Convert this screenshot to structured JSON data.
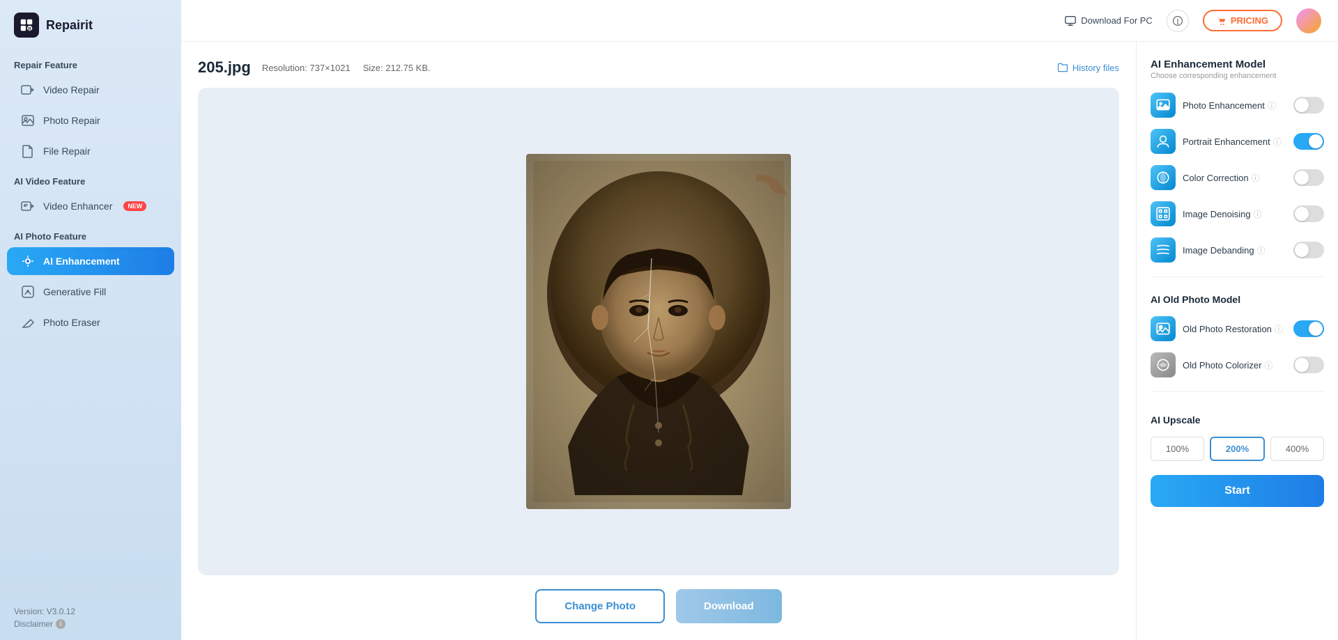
{
  "app": {
    "name": "Repairit",
    "version": "Version: V3.0.12",
    "disclaimer": "Disclaimer"
  },
  "header": {
    "download_for_pc": "Download For PC",
    "pricing": "PRICING",
    "help_icon": "?"
  },
  "sidebar": {
    "repair_feature_label": "Repair Feature",
    "items_repair": [
      {
        "id": "video-repair",
        "label": "Video Repair"
      },
      {
        "id": "photo-repair",
        "label": "Photo Repair"
      },
      {
        "id": "file-repair",
        "label": "File Repair"
      }
    ],
    "ai_video_feature_label": "AI Video Feature",
    "items_ai_video": [
      {
        "id": "video-enhancer",
        "label": "Video Enhancer",
        "badge": "NEW"
      }
    ],
    "ai_photo_feature_label": "AI Photo Feature",
    "items_ai_photo": [
      {
        "id": "ai-enhancement",
        "label": "AI Enhancement",
        "active": true
      },
      {
        "id": "generative-fill",
        "label": "Generative Fill"
      },
      {
        "id": "photo-eraser",
        "label": "Photo Eraser"
      }
    ]
  },
  "file": {
    "name": "205.jpg",
    "resolution_label": "Resolution:",
    "resolution_value": "737×1021",
    "size_label": "Size:",
    "size_value": "212.75 KB."
  },
  "history_files": "History files",
  "right_panel": {
    "ai_enhancement_model_title": "AI Enhancement Model",
    "ai_enhancement_model_sub": "Choose corresponding enhancement",
    "features": [
      {
        "id": "photo-enhancement",
        "label": "Photo Enhancement",
        "on": false
      },
      {
        "id": "portrait-enhancement",
        "label": "Portrait Enhancement",
        "on": true
      },
      {
        "id": "color-correction",
        "label": "Color Correction",
        "on": false
      },
      {
        "id": "image-denoising",
        "label": "Image Denoising",
        "on": false
      },
      {
        "id": "image-debanding",
        "label": "Image Debanding",
        "on": false
      }
    ],
    "ai_old_photo_model_title": "AI Old Photo Model",
    "old_photo_features": [
      {
        "id": "old-photo-restoration",
        "label": "Old Photo Restoration",
        "on": true
      },
      {
        "id": "old-photo-colorizer",
        "label": "Old Photo Colorizer",
        "on": false
      }
    ],
    "ai_upscale_title": "AI Upscale",
    "upscale_options": [
      {
        "value": "100%",
        "active": false
      },
      {
        "value": "200%",
        "active": true
      },
      {
        "value": "400%",
        "active": false
      }
    ],
    "start_label": "Start"
  },
  "buttons": {
    "change_photo": "Change Photo",
    "download": "Download"
  },
  "colors": {
    "accent": "#29a9f5",
    "toggle_on": "#29a9f5",
    "sidebar_active": "#1e7de6",
    "pricing_border": "#ff6b35"
  }
}
